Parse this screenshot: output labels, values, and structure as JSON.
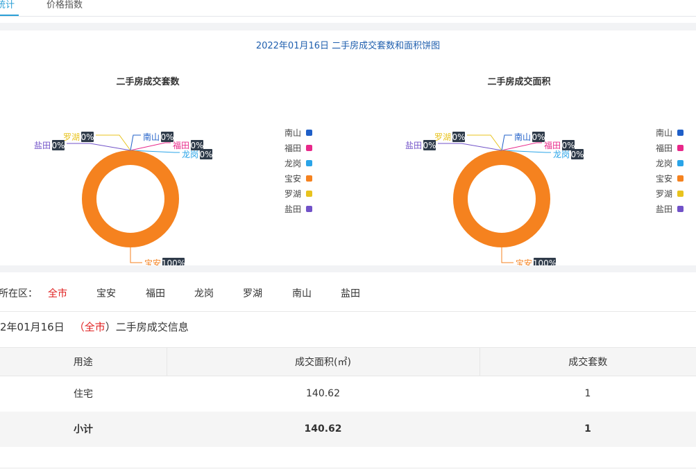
{
  "tabs": [
    {
      "label": "统计",
      "active": true
    },
    {
      "label": "价格指数",
      "active": false
    }
  ],
  "chart_panel_title": "2022年01月16日 二手房成交套数和面积饼图",
  "chart_data": [
    {
      "type": "pie",
      "title": "二手房成交套数",
      "series": [
        {
          "name": "南山",
          "value": 0,
          "label": "0%",
          "color": "#1f5fc8"
        },
        {
          "name": "福田",
          "value": 0,
          "label": "0%",
          "color": "#e8288a"
        },
        {
          "name": "龙岗",
          "value": 0,
          "label": "0%",
          "color": "#2aa4e8"
        },
        {
          "name": "宝安",
          "value": 100,
          "label": "100%",
          "color": "#f5821f"
        },
        {
          "name": "罗湖",
          "value": 0,
          "label": "0%",
          "color": "#e8c31e"
        },
        {
          "name": "盐田",
          "value": 0,
          "label": "0%",
          "color": "#7152c8"
        }
      ],
      "legend_position": "right"
    },
    {
      "type": "pie",
      "title": "二手房成交面积",
      "series": [
        {
          "name": "南山",
          "value": 0,
          "label": "0%",
          "color": "#1f5fc8"
        },
        {
          "name": "福田",
          "value": 0,
          "label": "0%",
          "color": "#e8288a"
        },
        {
          "name": "龙岗",
          "value": 0,
          "label": "0%",
          "color": "#2aa4e8"
        },
        {
          "name": "宝安",
          "value": 100,
          "label": "100%",
          "color": "#f5821f"
        },
        {
          "name": "罗湖",
          "value": 0,
          "label": "0%",
          "color": "#e8c31e"
        },
        {
          "name": "盐田",
          "value": 0,
          "label": "0%",
          "color": "#7152c8"
        }
      ],
      "legend_position": "right"
    }
  ],
  "filter": {
    "label": "所在区：",
    "options": [
      {
        "label": "全市",
        "active": true
      },
      {
        "label": "宝安",
        "active": false
      },
      {
        "label": "福田",
        "active": false
      },
      {
        "label": "龙岗",
        "active": false
      },
      {
        "label": "罗湖",
        "active": false
      },
      {
        "label": "南山",
        "active": false
      },
      {
        "label": "盐田",
        "active": false
      }
    ]
  },
  "info": {
    "date": "2年01月16日",
    "paren_open": "（",
    "district": "全市",
    "paren_close": "）",
    "suffix": "二手房成交信息"
  },
  "table": {
    "headers": [
      "用途",
      "成交面积(㎡)",
      "成交套数"
    ],
    "rows": [
      {
        "use": "住宅",
        "area": "140.62",
        "count": "1"
      }
    ],
    "subtotal": {
      "use": "小计",
      "area": "140.62",
      "count": "1"
    }
  }
}
